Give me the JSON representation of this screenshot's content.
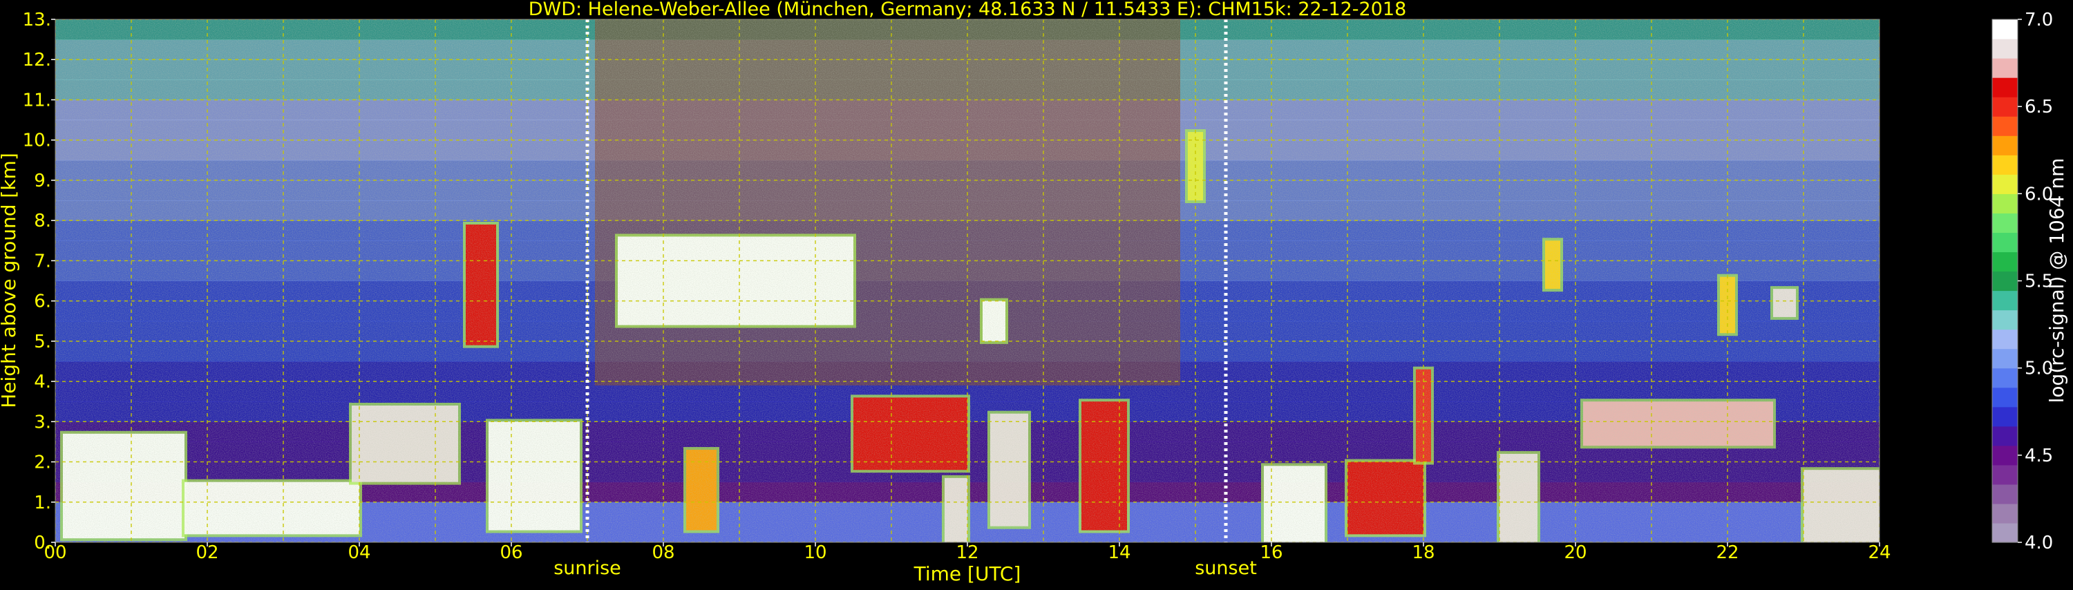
{
  "chart_data": {
    "type": "heatmap",
    "title": "DWD: Helene-Weber-Allee (München, Germany; 48.1633 N / 11.5433 E):    CHM15k: 22-12-2018",
    "xlabel": "Time [UTC]",
    "ylabel": "Height above ground [km]",
    "xlim": [
      0,
      24
    ],
    "ylim": [
      0,
      13
    ],
    "x_ticks": [
      "00",
      "02",
      "04",
      "06",
      "08",
      "10",
      "12",
      "14",
      "16",
      "18",
      "20",
      "22",
      "24"
    ],
    "y_ticks": [
      "0.",
      "1.",
      "2.",
      "3.",
      "4.",
      "5.",
      "6.",
      "7.",
      "8.",
      "9.",
      "10.",
      "11.",
      "12.",
      "13."
    ],
    "grid": true,
    "annotations": [
      {
        "text": "sunrise",
        "x": 7.0
      },
      {
        "text": "sunset",
        "x": 15.4
      }
    ],
    "colorbar": {
      "label": "log(rc-signal) @ 1064 nm",
      "range": [
        4.0,
        7.0
      ],
      "ticks": [
        "4.0",
        "4.5",
        "5.0",
        "5.5",
        "6.0",
        "6.5",
        "7.0"
      ],
      "colors": [
        "#a99bbf",
        "#9d80b0",
        "#8a5aa3",
        "#7a2f98",
        "#6a0f8e",
        "#4a16a6",
        "#2f2fcf",
        "#3a55e8",
        "#5a7cf0",
        "#7f9ff2",
        "#a3b8f5",
        "#7fd0d0",
        "#3fbf9f",
        "#1f9f4f",
        "#22b84a",
        "#47d86b",
        "#6fe86f",
        "#a8ee4f",
        "#e8f03a",
        "#ffd21a",
        "#ff9f0a",
        "#ff5a1a",
        "#f02a1a",
        "#e00a0a",
        "#eeb5b5",
        "#ece2e2",
        "#ffffff"
      ]
    },
    "features": [
      {
        "kind": "boundary_layer",
        "t0": 0.0,
        "t1": 24.0,
        "h0": 0.0,
        "h1": 1.0,
        "level": 4.9
      },
      {
        "kind": "cloud",
        "t0": 0.1,
        "t1": 1.7,
        "h0": 0.1,
        "h1": 2.7,
        "level": 6.9
      },
      {
        "kind": "cloud",
        "t0": 1.7,
        "t1": 4.0,
        "h0": 0.2,
        "h1": 1.5,
        "level": 6.9
      },
      {
        "kind": "cloud",
        "t0": 3.9,
        "t1": 5.3,
        "h0": 1.5,
        "h1": 3.4,
        "level": 6.8
      },
      {
        "kind": "cloud",
        "t0": 5.4,
        "t1": 5.8,
        "h0": 4.9,
        "h1": 7.9,
        "level": 6.6
      },
      {
        "kind": "cloud",
        "t0": 5.7,
        "t1": 6.9,
        "h0": 0.3,
        "h1": 3.0,
        "level": 6.9
      },
      {
        "kind": "cloud",
        "t0": 7.4,
        "t1": 10.5,
        "h0": 5.4,
        "h1": 7.6,
        "level": 6.9
      },
      {
        "kind": "cloud",
        "t0": 8.3,
        "t1": 8.7,
        "h0": 0.3,
        "h1": 2.3,
        "level": 6.3
      },
      {
        "kind": "cloud",
        "t0": 10.5,
        "t1": 12.0,
        "h0": 1.8,
        "h1": 3.6,
        "level": 6.6
      },
      {
        "kind": "cloud",
        "t0": 11.7,
        "t1": 12.0,
        "h0": 0.0,
        "h1": 1.6,
        "level": 6.8
      },
      {
        "kind": "cloud",
        "t0": 12.2,
        "t1": 12.5,
        "h0": 5.0,
        "h1": 6.0,
        "level": 6.9
      },
      {
        "kind": "cloud",
        "t0": 12.3,
        "t1": 12.8,
        "h0": 0.4,
        "h1": 3.2,
        "level": 6.8
      },
      {
        "kind": "cloud",
        "t0": 13.5,
        "t1": 14.1,
        "h0": 0.3,
        "h1": 3.5,
        "level": 6.6
      },
      {
        "kind": "cloud",
        "t0": 14.9,
        "t1": 15.1,
        "h0": 8.5,
        "h1": 10.2,
        "level": 6.1
      },
      {
        "kind": "cloud",
        "t0": 15.9,
        "t1": 16.7,
        "h0": 0.0,
        "h1": 1.9,
        "level": 6.9
      },
      {
        "kind": "cloud",
        "t0": 17.0,
        "t1": 18.0,
        "h0": 0.2,
        "h1": 2.0,
        "level": 6.6
      },
      {
        "kind": "cloud",
        "t0": 17.9,
        "t1": 18.1,
        "h0": 2.0,
        "h1": 4.3,
        "level": 6.5
      },
      {
        "kind": "cloud",
        "t0": 19.0,
        "t1": 19.5,
        "h0": 0.0,
        "h1": 2.2,
        "level": 6.8
      },
      {
        "kind": "cloud",
        "t0": 19.6,
        "t1": 19.8,
        "h0": 6.3,
        "h1": 7.5,
        "level": 6.2
      },
      {
        "kind": "cloud",
        "t0": 20.1,
        "t1": 22.6,
        "h0": 2.4,
        "h1": 3.5,
        "level": 6.7
      },
      {
        "kind": "cloud",
        "t0": 21.9,
        "t1": 22.1,
        "h0": 5.2,
        "h1": 6.6,
        "level": 6.2
      },
      {
        "kind": "cloud",
        "t0": 22.6,
        "t1": 22.9,
        "h0": 5.6,
        "h1": 6.3,
        "level": 6.8
      },
      {
        "kind": "cloud",
        "t0": 23.0,
        "t1": 24.0,
        "h0": 0.0,
        "h1": 1.8,
        "level": 6.8
      }
    ]
  }
}
